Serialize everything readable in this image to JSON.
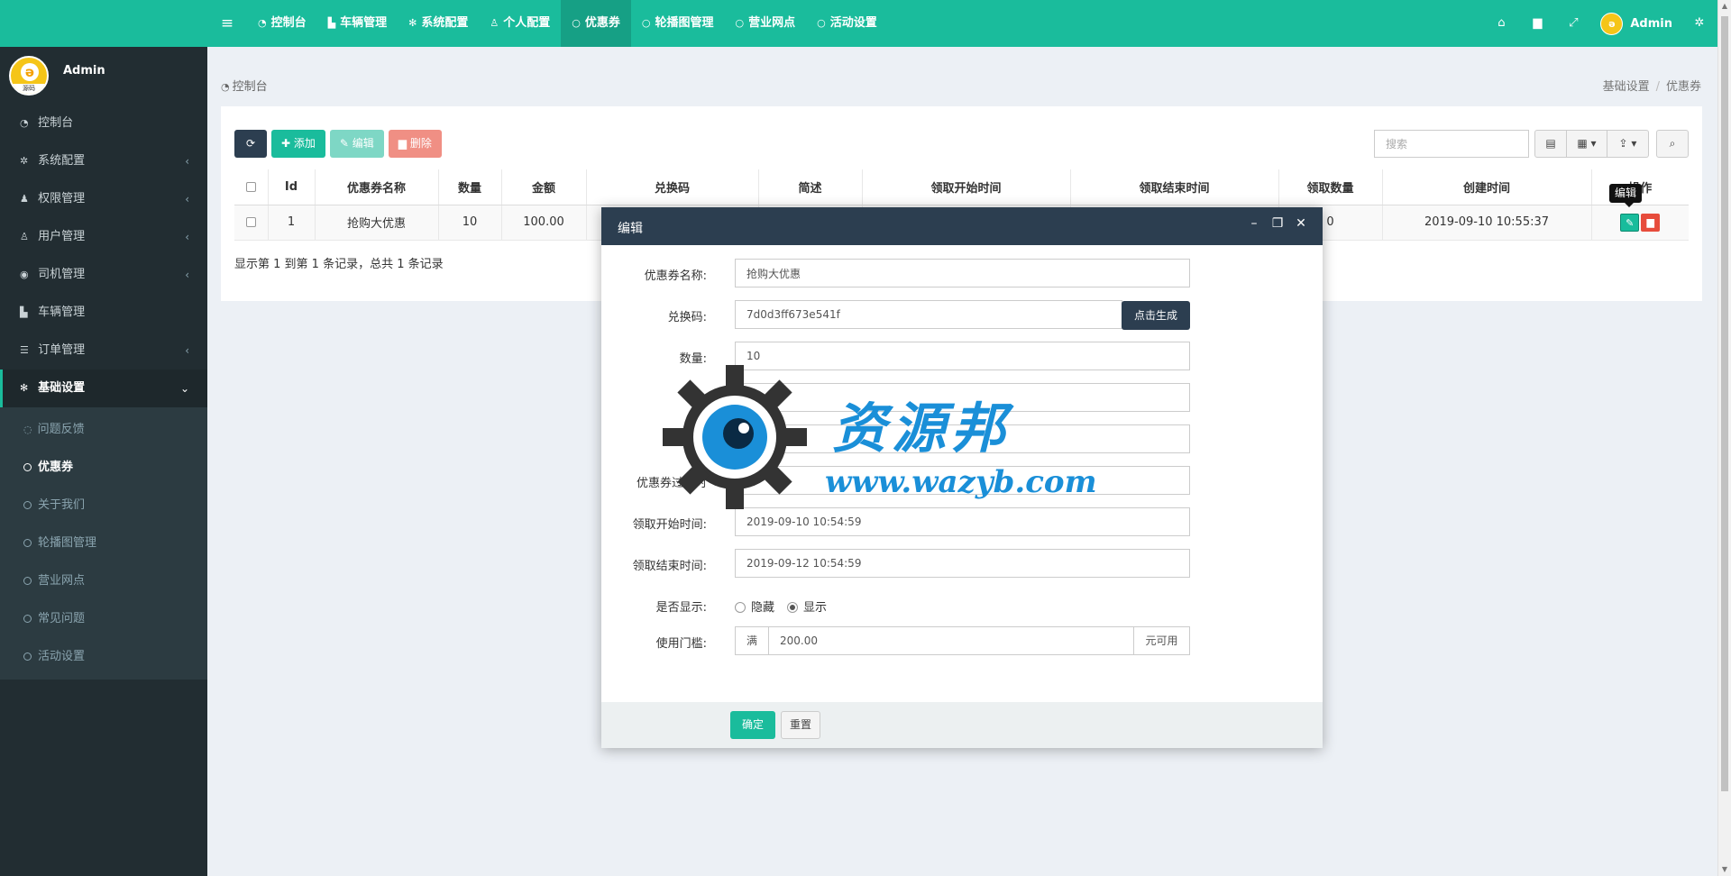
{
  "sidebar": {
    "user_name": "Admin",
    "logo_text": "源码",
    "menu": [
      {
        "label": "控制台",
        "icon": "dashboard-icon",
        "has_children": false
      },
      {
        "label": "系统配置",
        "icon": "cogs-icon",
        "has_children": true
      },
      {
        "label": "权限管理",
        "icon": "group-icon",
        "has_children": true
      },
      {
        "label": "用户管理",
        "icon": "user-icon",
        "has_children": true
      },
      {
        "label": "司机管理",
        "icon": "user-circle-icon",
        "has_children": true
      },
      {
        "label": "车辆管理",
        "icon": "truck-icon",
        "has_children": false
      },
      {
        "label": "订单管理",
        "icon": "list-icon",
        "has_children": true
      },
      {
        "label": "基础设置",
        "icon": "gear-icon",
        "has_children": true,
        "expanded": true
      }
    ],
    "submenu": [
      {
        "label": "问题反馈",
        "icon": "comment-icon"
      },
      {
        "label": "优惠券",
        "icon": "circle-icon",
        "active": true
      },
      {
        "label": "关于我们",
        "icon": "circle-icon"
      },
      {
        "label": "轮播图管理",
        "icon": "circle-icon"
      },
      {
        "label": "营业网点",
        "icon": "circle-icon"
      },
      {
        "label": "常见问题",
        "icon": "circle-icon"
      },
      {
        "label": "活动设置",
        "icon": "circle-icon"
      }
    ]
  },
  "navbar": {
    "tabs": [
      {
        "label": "控制台",
        "icon": "dashboard-icon"
      },
      {
        "label": "车辆管理",
        "icon": "truck-icon"
      },
      {
        "label": "系统配置",
        "icon": "gear-icon"
      },
      {
        "label": "个人配置",
        "icon": "user-icon"
      },
      {
        "label": "优惠券",
        "icon": "circle-icon",
        "active": true
      },
      {
        "label": "轮播图管理",
        "icon": "circle-icon"
      },
      {
        "label": "营业网点",
        "icon": "circle-icon"
      },
      {
        "label": "活动设置",
        "icon": "circle-icon"
      }
    ],
    "user_name": "Admin"
  },
  "content_header": {
    "title": "控制台",
    "breadcrumb": [
      "基础设置",
      "优惠券"
    ]
  },
  "toolbar": {
    "add_label": "添加",
    "edit_label": "编辑",
    "delete_label": "删除",
    "search_placeholder": "搜索"
  },
  "table": {
    "columns": [
      "Id",
      "优惠券名称",
      "数量",
      "金额",
      "兑换码",
      "简述",
      "领取开始时间",
      "领取结束时间",
      "领取数量",
      "创建时间",
      "操作"
    ],
    "rows": [
      {
        "id": "1",
        "name": "抢购大优惠",
        "quantity": "10",
        "amount": "100.00",
        "received": "0",
        "created": "2019-09-10 10:55:37"
      }
    ],
    "tooltip": "编辑",
    "pager_info": "显示第 1 到第 1 条记录，总共 1 条记录"
  },
  "modal": {
    "title": "编辑",
    "fields": {
      "name_label": "优惠券名称:",
      "name_value": "抢购大优惠",
      "code_label": "兑换码:",
      "code_value": "7d0d3ff673e541f",
      "generate_label": "点击生成",
      "quantity_label": "数量:",
      "quantity_value": "10",
      "amount_label_partial": "金",
      "amount_value_partial": "10",
      "desc_label_partial": "述:",
      "desc_value_partial": "送",
      "expire_label": "优惠券过期时",
      "expire_value_partial": "15",
      "start_label": "领取开始时间:",
      "start_value": "2019-09-10 10:54:59",
      "end_label": "领取结束时间:",
      "end_value": "2019-09-12 10:54:59",
      "show_label": "是否显示:",
      "hide_option": "隐藏",
      "show_option": "显示",
      "threshold_label": "使用门槛:",
      "threshold_prefix": "满",
      "threshold_value": "200.00",
      "threshold_suffix": "元可用"
    },
    "ok_label": "确定",
    "reset_label": "重置"
  },
  "watermark": {
    "line1": "资源邦",
    "line2": "www.wazyb.com"
  },
  "colors": {
    "accent": "#1abc9c",
    "sidebar_bg": "#222d32",
    "modal_header": "#2c3e50",
    "danger": "#e74c3c"
  }
}
